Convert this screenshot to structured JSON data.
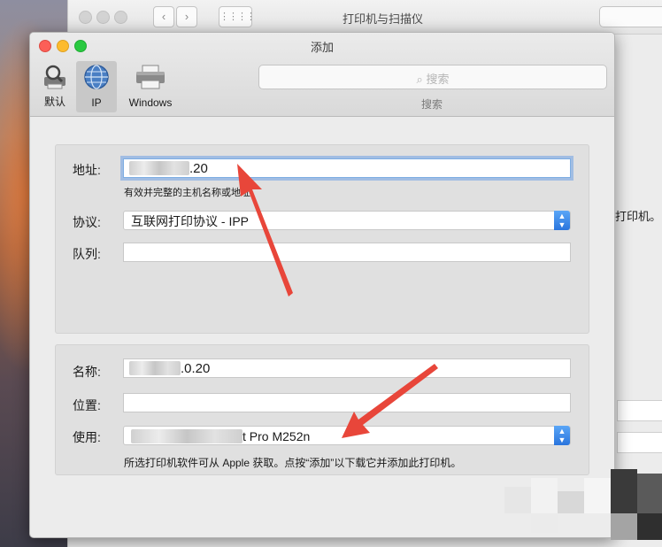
{
  "back_window": {
    "title": "打印机与扫描仪",
    "nav_back": "‹",
    "nav_forward": "›",
    "grid_icon": "⋮⋮⋮⋮",
    "right_text": "打印机。"
  },
  "dialog": {
    "title": "添加",
    "toolbar": {
      "tabs": [
        {
          "label": "默认",
          "icon": "magnifier-printer-icon"
        },
        {
          "label": "IP",
          "icon": "globe-icon",
          "selected": true
        },
        {
          "label": "Windows",
          "icon": "printer-icon"
        }
      ],
      "search_placeholder": "搜索",
      "search_caption": "搜索"
    },
    "address": {
      "label": "地址:",
      "value_visible": ".20",
      "hint": "有效并完整的主机名称或地址。"
    },
    "protocol": {
      "label": "协议:",
      "value": "互联网打印协议 - IPP"
    },
    "queue": {
      "label": "队列:",
      "value": ""
    },
    "name": {
      "label": "名称:",
      "value_visible": ".0.20"
    },
    "location": {
      "label": "位置:",
      "value": ""
    },
    "use": {
      "label": "使用:",
      "value_visible": "t Pro M252n"
    },
    "footer_note": "所选打印机软件可从 Apple 获取。点按“添加”以下载它并添加此打印机。"
  },
  "colors": {
    "focus_ring": "#7eaee3",
    "annotation_arrow": "#e8463a",
    "stepper_blue": "#2a75dd"
  }
}
